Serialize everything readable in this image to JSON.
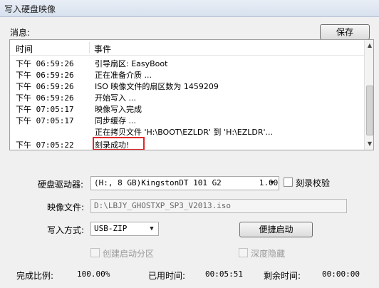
{
  "window": {
    "title": "写入硬盘映像"
  },
  "messages": {
    "label": "消息:",
    "save_label": "保存",
    "columns": {
      "time": "时间",
      "event": "事件"
    },
    "rows": [
      {
        "time": "下午 06:59:26",
        "event": "引导扇区: EasyBoot"
      },
      {
        "time": "下午 06:59:26",
        "event": "正在准备介质 ..."
      },
      {
        "time": "下午 06:59:26",
        "event": "ISO 映像文件的扇区数为 1459209"
      },
      {
        "time": "下午 06:59:26",
        "event": "开始写入 ..."
      },
      {
        "time": "下午 07:05:17",
        "event": "映像写入完成"
      },
      {
        "time": "下午 07:05:17",
        "event": "同步缓存 ..."
      },
      {
        "time": "",
        "event": "正在拷贝文件 'H:\\BOOT\\EZLDR' 到 'H:\\EZLDR'..."
      },
      {
        "time": "下午 07:05:22",
        "event": "刻录成功!"
      }
    ]
  },
  "drive": {
    "label": "硬盘驱动器:",
    "value": "(H:, 8 GB)KingstonDT 101 G2        1.00",
    "verify_label": "刻录校验"
  },
  "image_file": {
    "label": "映像文件:",
    "value": "D:\\LBJY_GHOSTXP_SP3_V2013.iso"
  },
  "write_mode": {
    "label": "写入方式:",
    "value": "USB-ZIP",
    "quick_boot_label": "便捷启动"
  },
  "options": {
    "boot_partition_label": "创建启动分区",
    "deep_hide_label": "深度隐藏"
  },
  "status": {
    "ratio_label": "完成比例:",
    "ratio_value": "100.00%",
    "elapsed_label": "已用时间:",
    "elapsed_value": "00:05:51",
    "remaining_label": "剩余时间:",
    "remaining_value": "00:00:00"
  }
}
